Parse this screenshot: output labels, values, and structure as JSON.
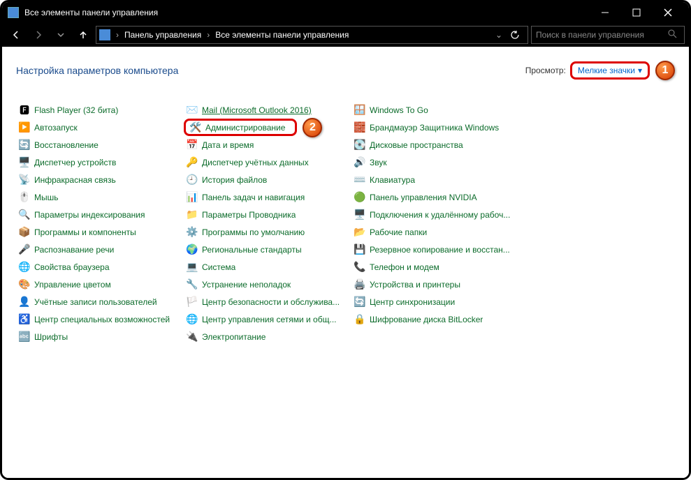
{
  "window": {
    "title": "Все элементы панели управления"
  },
  "nav": {
    "breadcrumb": [
      "Панель управления",
      "Все элементы панели управления"
    ],
    "search_placeholder": "Поиск в панели управления"
  },
  "header": {
    "title": "Настройка параметров компьютера",
    "view_label": "Просмотр:",
    "view_value": "Мелкие значки"
  },
  "badges": {
    "one": "1",
    "two": "2"
  },
  "items": {
    "c1": [
      "Flash Player (32 бита)",
      "Автозапуск",
      "Восстановление",
      "Диспетчер устройств",
      "Инфракрасная связь",
      "Мышь",
      "Параметры индексирования",
      "Программы и компоненты",
      "Распознавание речи",
      "Свойства браузера",
      "Управление цветом",
      "Учётные записи пользователей",
      "Центр специальных возможностей",
      "Шрифты"
    ],
    "c2": [
      "Mail (Microsoft Outlook 2016)",
      "Администрирование",
      "Дата и время",
      "Диспетчер учётных данных",
      "История файлов",
      "Панель задач и навигация",
      "Параметры Проводника",
      "Программы по умолчанию",
      "Региональные стандарты",
      "Система",
      "Устранение неполадок",
      "Центр безопасности и обслужива...",
      "Центр управления сетями и общ...",
      "Электропитание"
    ],
    "c3": [
      "Windows To Go",
      "Брандмауэр Защитника Windows",
      "Дисковые пространства",
      "Звук",
      "Клавиатура",
      "Панель управления NVIDIA",
      "Подключения к удалённому рабоч...",
      "Рабочие папки",
      "Резервное копирование и восстан...",
      "Телефон и модем",
      "Устройства и принтеры",
      "Центр синхронизации",
      "Шифрование диска BitLocker"
    ]
  },
  "icons": {
    "c1": [
      "🅵",
      "▶️",
      "🔄",
      "🖥️",
      "📡",
      "🖱️",
      "🔍",
      "📦",
      "🎤",
      "🌐",
      "🎨",
      "👤",
      "♿",
      "🔤"
    ],
    "c2": [
      "✉️",
      "🛠️",
      "📅",
      "🔑",
      "🕘",
      "📊",
      "📁",
      "⚙️",
      "🌍",
      "💻",
      "🔧",
      "🏳️",
      "🌐",
      "🔌"
    ],
    "c3": [
      "🪟",
      "🧱",
      "💽",
      "🔊",
      "⌨️",
      "🟢",
      "🖥️",
      "📂",
      "💾",
      "📞",
      "🖨️",
      "🔄",
      "🔒"
    ]
  }
}
